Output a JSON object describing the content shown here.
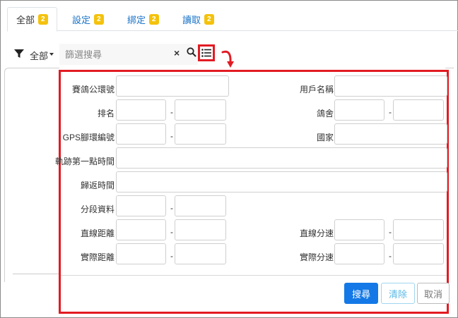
{
  "tabs": [
    {
      "label": "全部",
      "count": "2"
    },
    {
      "label": "設定",
      "count": "2"
    },
    {
      "label": "綁定",
      "count": "2"
    },
    {
      "label": "讀取",
      "count": "2"
    }
  ],
  "toolbar": {
    "filter_label": "全部",
    "search_placeholder": "篩選搜尋",
    "clear_icon": "×",
    "icons": [
      "filter-icon",
      "search-icon",
      "list-icon",
      "arrow-icon"
    ]
  },
  "form": {
    "ring_id_label": "賽鴿公環號",
    "user_name_label": "用戶名稱",
    "rank_label": "排名",
    "loft_label": "鴿舍",
    "gps_label": "GPS腳環編號",
    "country_label": "國家",
    "first_point_label": "軌跡第一點時間",
    "return_time_label": "歸返時間",
    "segment_label": "分段資料",
    "straight_dist_label": "直線距離",
    "straight_speed_label": "直線分速",
    "actual_dist_label": "實際距離",
    "actual_speed_label": "實際分速",
    "range_separator": "-"
  },
  "buttons": {
    "search": "搜尋",
    "clear": "清除",
    "cancel": "取消"
  },
  "colors": {
    "highlight": "#e21b23",
    "badge": "#f4c20d",
    "primary": "#1479e6",
    "tab_link": "#1a73c8"
  }
}
